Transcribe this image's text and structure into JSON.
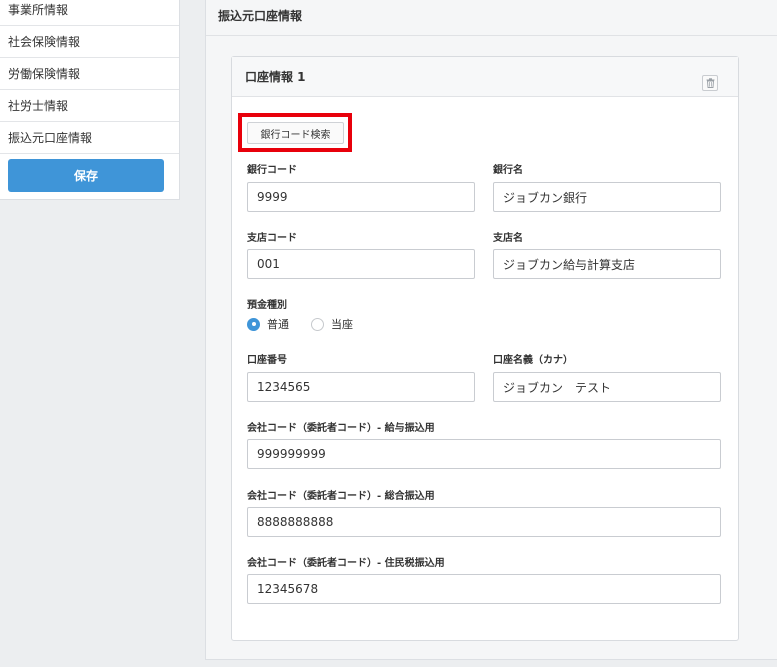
{
  "sidebar": {
    "items": [
      {
        "label": "事業所情報"
      },
      {
        "label": "社会保険情報"
      },
      {
        "label": "労働保険情報"
      },
      {
        "label": "社労士情報"
      },
      {
        "label": "振込元口座情報"
      }
    ],
    "save_label": "保存"
  },
  "main": {
    "title": "振込元口座情報",
    "card": {
      "title": "口座情報 1",
      "trash_icon": "trash-icon",
      "bank_search_label": "銀行コード検索",
      "fields": {
        "bank_code": {
          "label": "銀行コード",
          "value": "9999"
        },
        "bank_name": {
          "label": "銀行名",
          "value": "ジョブカン銀行"
        },
        "branch_code": {
          "label": "支店コード",
          "value": "001"
        },
        "branch_name": {
          "label": "支店名",
          "value": "ジョブカン給与計算支店"
        },
        "deposit_type": {
          "label": "預金種別",
          "options": [
            {
              "label": "普通",
              "selected": true
            },
            {
              "label": "当座",
              "selected": false
            }
          ]
        },
        "account_number": {
          "label": "口座番号",
          "value": "1234565"
        },
        "account_name": {
          "label": "口座名義（カナ）",
          "value": "ジョブカン　テスト"
        },
        "company_code_salary": {
          "label": "会社コード（委託者コード）- 給与振込用",
          "value": "999999999"
        },
        "company_code_general": {
          "label": "会社コード（委託者コード）- 総合振込用",
          "value": "8888888888"
        },
        "company_code_resident_tax": {
          "label": "会社コード（委託者コード）- 住民税振込用",
          "value": "12345678"
        }
      }
    }
  },
  "colors": {
    "accent": "#3f95d8",
    "highlight": "#e8000b"
  }
}
